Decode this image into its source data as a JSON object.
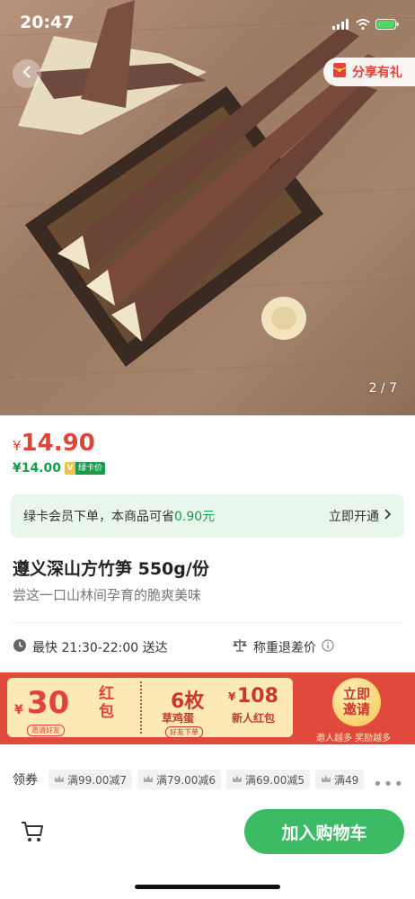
{
  "status_bar": {
    "time": "20:47"
  },
  "hero": {
    "share_label": "分享有礼",
    "page_indicator": "2 / 7"
  },
  "price": {
    "currency": "¥",
    "current": "14.90",
    "member_price": "¥14.00",
    "member_badge_v": "V",
    "member_badge_text": "绿卡价"
  },
  "card_banner": {
    "text_prefix": "绿卡会员下单，本商品可省",
    "saving": "0.90元",
    "action": "立即开通"
  },
  "product": {
    "title": "遵义深山方竹笋 550g/份",
    "subtitle": "尝这一口山林间孕育的脆爽美味"
  },
  "delivery": {
    "time_text": "最快 21:30-22:00 送达",
    "weigh_text": "称重退差价"
  },
  "promo": {
    "coupon1_symbol": "¥",
    "coupon1_value": "30",
    "coupon1_unit": "红包",
    "coupon1_tag": "邀请好友",
    "coupon2_value": "6枚",
    "coupon2_name": "草鸡蛋",
    "coupon2_tag": "好友下单",
    "coupon3_symbol": "¥",
    "coupon3_value": "108",
    "coupon3_name": "新人红包",
    "invite_label": "立即邀请",
    "invite_sub": "邀人越多 奖励越多"
  },
  "coupons": {
    "label": "领券",
    "items": [
      "满99.00减7",
      "满79.00减6",
      "满69.00减5",
      "满49"
    ]
  },
  "bottom": {
    "add_to_cart": "加入购物车"
  },
  "colors": {
    "price_red": "#e0433a",
    "member_green": "#1a9d4a",
    "cart_green": "#3dbb64",
    "banner_bg": "#e8f6ec"
  }
}
